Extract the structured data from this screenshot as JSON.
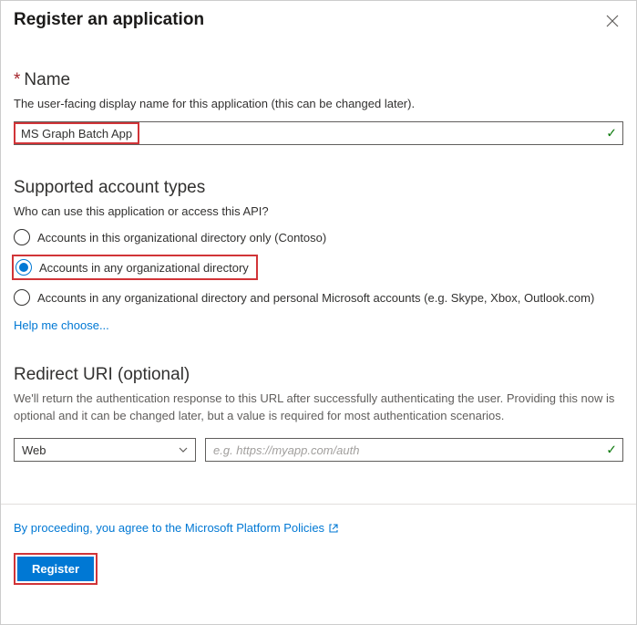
{
  "header": {
    "title": "Register an application"
  },
  "name_section": {
    "label": "Name",
    "help": "The user-facing display name for this application (this can be changed later).",
    "value": "MS Graph Batch App"
  },
  "account_types": {
    "label": "Supported account types",
    "help": "Who can use this application or access this API?",
    "options": [
      {
        "label": "Accounts in this organizational directory only (Contoso)",
        "selected": false
      },
      {
        "label": "Accounts in any organizational directory",
        "selected": true
      },
      {
        "label": "Accounts in any organizational directory and personal Microsoft accounts (e.g. Skype, Xbox, Outlook.com)",
        "selected": false
      }
    ],
    "help_link": "Help me choose..."
  },
  "redirect": {
    "label": "Redirect URI (optional)",
    "help": "We'll return the authentication response to this URL after successfully authenticating the user. Providing this now is optional and it can be changed later, but a value is required for most authentication scenarios.",
    "platform_selected": "Web",
    "url_placeholder": "e.g. https://myapp.com/auth"
  },
  "footer": {
    "policies_text": "By proceeding, you agree to the Microsoft Platform Policies",
    "register_label": "Register"
  }
}
